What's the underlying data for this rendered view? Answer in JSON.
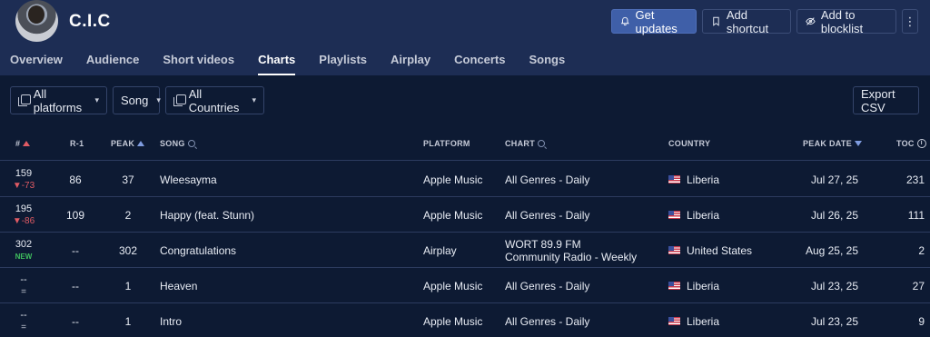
{
  "artist": {
    "name": "C.I.C"
  },
  "header_buttons": {
    "get_updates": "Get updates",
    "add_shortcut": "Add shortcut",
    "add_blocklist": "Add to blocklist",
    "more": "⋮"
  },
  "tabs": [
    {
      "label": "Overview",
      "active": false
    },
    {
      "label": "Audience",
      "active": false
    },
    {
      "label": "Short videos",
      "active": false
    },
    {
      "label": "Charts",
      "active": true
    },
    {
      "label": "Playlists",
      "active": false
    },
    {
      "label": "Airplay",
      "active": false
    },
    {
      "label": "Concerts",
      "active": false
    },
    {
      "label": "Songs",
      "active": false
    }
  ],
  "filters": {
    "platforms": "All platforms",
    "type": "Song",
    "countries": "All Countries",
    "export": "Export CSV"
  },
  "columns": {
    "rank": "#",
    "r1": "R-1",
    "peak": "PEAK",
    "song": "SONG",
    "platform": "PLATFORM",
    "chart": "CHART",
    "country": "COUNTRY",
    "peak_date": "PEAK DATE",
    "toc": "TOC"
  },
  "rows": [
    {
      "rank": "159",
      "change": "▼-73",
      "change_type": "down",
      "r1": "86",
      "peak": "37",
      "song": "Wleesayma",
      "platform": "Apple Music",
      "chart": [
        "All Genres - Daily"
      ],
      "country": "Liberia",
      "peak_date": "Jul 27, 25",
      "toc": "231"
    },
    {
      "rank": "195",
      "change": "▼-86",
      "change_type": "down",
      "r1": "109",
      "peak": "2",
      "song": "Happy (feat. Stunn)",
      "platform": "Apple Music",
      "chart": [
        "All Genres - Daily"
      ],
      "country": "Liberia",
      "peak_date": "Jul 26, 25",
      "toc": "111"
    },
    {
      "rank": "302",
      "change": "NEW",
      "change_type": "new",
      "r1": "--",
      "peak": "302",
      "song": "Congratulations",
      "platform": "Airplay",
      "chart": [
        "WORT 89.9 FM",
        "Community Radio - Weekly"
      ],
      "country": "United States",
      "peak_date": "Aug 25, 25",
      "toc": "2"
    },
    {
      "rank": "--",
      "change": "=",
      "change_type": "same",
      "r1": "--",
      "peak": "1",
      "song": "Heaven",
      "platform": "Apple Music",
      "chart": [
        "All Genres - Daily"
      ],
      "country": "Liberia",
      "peak_date": "Jul 23, 25",
      "toc": "27"
    },
    {
      "rank": "--",
      "change": "=",
      "change_type": "same",
      "r1": "--",
      "peak": "1",
      "song": "Intro",
      "platform": "Apple Music",
      "chart": [
        "All Genres - Daily"
      ],
      "country": "Liberia",
      "peak_date": "Jul 23, 25",
      "toc": "9"
    }
  ],
  "colors": {
    "header_bg": "#1d2d54",
    "page_bg": "#0d1a33",
    "accent": "#3f5fa8",
    "down": "#e15b64",
    "new": "#3fbf5e"
  }
}
